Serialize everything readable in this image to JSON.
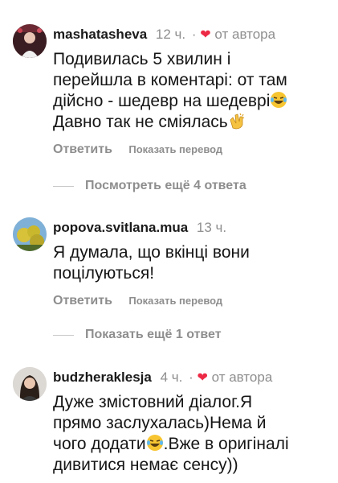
{
  "comments": [
    {
      "username": "mashatasheva",
      "time": "12 ч.",
      "dot": "·",
      "by_author": "от автора",
      "lines": [
        "Подивилась 5 хвилин і",
        "перейшла в коментарі: от там",
        "дійсно - шедевр на шедеврі",
        "Давно так не сміялась"
      ],
      "reply_label": "Ответить",
      "translate_label": "Показать перевод"
    },
    {
      "username": "popova.svitlana.mua",
      "time": "13 ч.",
      "lines": [
        "Я думала, що вкінці вони",
        "поцілуються!"
      ],
      "reply_label": "Ответить",
      "translate_label": "Показать перевод"
    },
    {
      "username": "budzheraklesja",
      "time": "4 ч.",
      "dot": "·",
      "by_author": "от автора",
      "lines": [
        "Дуже змістовний діалог.Я",
        "прямо заслухалась)Нема й",
        "чого додати",
        ".Вже в оригіналі",
        "дивитися немає сенсу))"
      ]
    }
  ],
  "threads": {
    "more_replies_1": "Посмотреть ещё 4 ответа",
    "more_replies_2": "Показать ещё 1 ответ"
  },
  "icons": {
    "heart": "heart-icon",
    "laugh": "laughing-tears-emoji",
    "clap": "clapping-hands-emoji"
  },
  "colors": {
    "heart": "#ed2a45",
    "meta": "#8e8e8e",
    "text": "#151515"
  }
}
